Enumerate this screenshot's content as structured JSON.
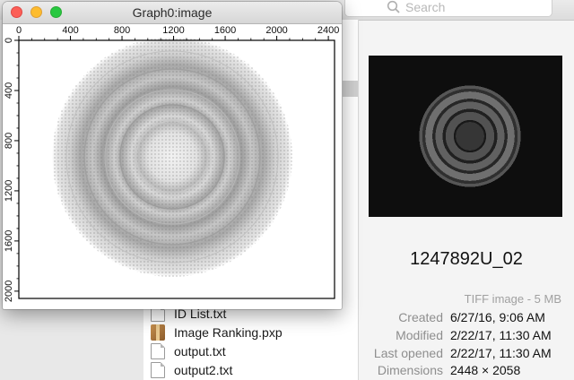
{
  "finder": {
    "search": {
      "placeholder": "Search"
    },
    "files": [
      {
        "name": "ID List.txt",
        "icon": "document-icon"
      },
      {
        "name": "Image Ranking.pxp",
        "icon": "package-icon"
      },
      {
        "name": "output.txt",
        "icon": "document-icon"
      },
      {
        "name": "output2.txt",
        "icon": "document-icon"
      }
    ],
    "preview": {
      "filename": "1247892U_02",
      "kind": "TIFF image - 5 MB",
      "metadata": [
        {
          "key": "Created",
          "value": "6/27/16, 9:06 AM"
        },
        {
          "key": "Modified",
          "value": "2/22/17, 11:30 AM"
        },
        {
          "key": "Last opened",
          "value": "2/22/17, 11:30 AM"
        },
        {
          "key": "Dimensions",
          "value": "2448 × 2058"
        }
      ]
    }
  },
  "graph_window": {
    "title": "Graph0:image",
    "x_axis": {
      "ticks": [
        "0",
        "400",
        "800",
        "1200",
        "1600",
        "2000",
        "2400"
      ],
      "min": 0,
      "max": 2448
    },
    "y_axis": {
      "ticks": [
        "0",
        "400",
        "800",
        "1200",
        "1600",
        "2000"
      ],
      "min": 0,
      "max": 2058
    }
  },
  "colors": {
    "close": "#fc5f57",
    "minimize": "#fdbc2e",
    "zoom": "#28c840",
    "preview_background": "#0e0e0e"
  }
}
